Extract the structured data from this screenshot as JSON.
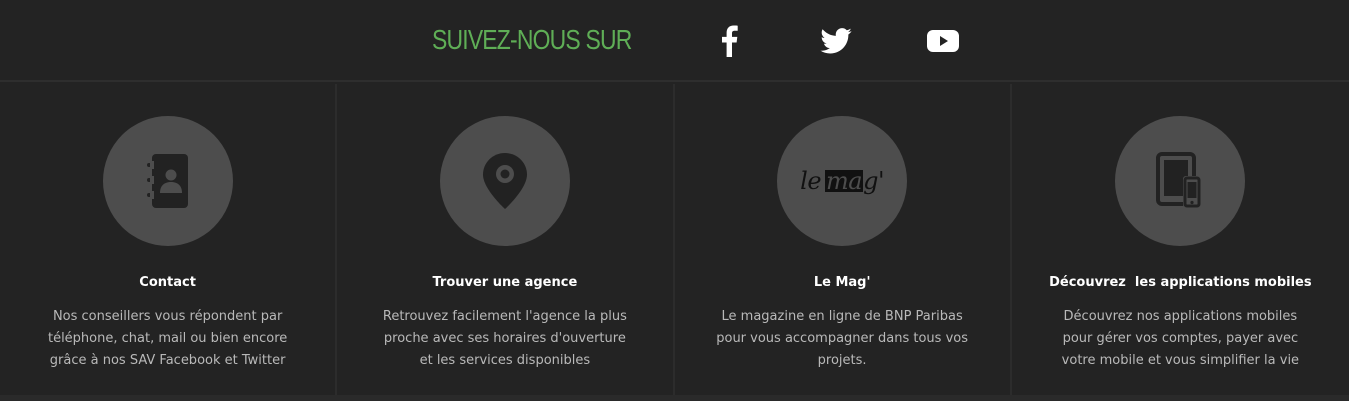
{
  "follow": {
    "title": "SUIVEZ-NOUS SUR",
    "title_color": "#5fae56",
    "social_icons": [
      "facebook-icon",
      "twitter-icon",
      "youtube-icon"
    ]
  },
  "columns": [
    {
      "icon": "address-book-icon",
      "title": "Contact",
      "description": [
        "Nos conseillers vous répondent par",
        "téléphone, chat, mail ou bien encore",
        "grâce à nos SAV Facebook et Twitter"
      ]
    },
    {
      "icon": "map-pin-icon",
      "title": "Trouver une agence",
      "description": [
        "Retrouvez facilement l'agence la plus",
        "proche avec ses horaires d'ouverture",
        "et les services disponibles"
      ]
    },
    {
      "icon": "le-mag-logo",
      "logo": {
        "le": "le",
        "mag": "ma",
        "rest": "g'"
      },
      "title": "Le Mag'",
      "description": [
        "Le magazine en ligne de BNP Paribas",
        "pour vous accompagner dans tous vos",
        "projets."
      ]
    },
    {
      "icon": "tablet-phone-icon",
      "title": "Découvrez  les applications mobiles",
      "description": [
        "Découvrez nos applications mobiles",
        "pour gérer vos comptes, payer avec",
        "votre mobile et vous simplifier la vie"
      ]
    }
  ]
}
